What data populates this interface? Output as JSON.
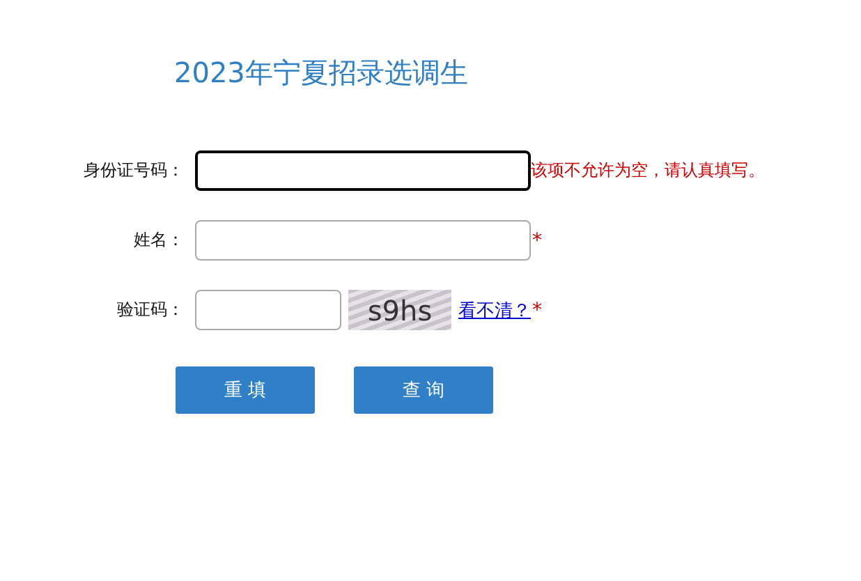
{
  "title": "2023年宁夏招录选调生",
  "fields": [
    {
      "kind": "text",
      "label": "身份证号码：",
      "focused": true,
      "error": "该项不允许为空，请认真填写。",
      "required": false
    },
    {
      "kind": "text",
      "label": "姓名：",
      "focused": false,
      "required": true,
      "required_mark": "*"
    },
    {
      "kind": "captcha",
      "label": "验证码：",
      "focused": false,
      "captcha": "s9hs",
      "refresh_link": "看不清？",
      "required": true,
      "required_mark": "*"
    }
  ],
  "buttons": [
    "重 填",
    "查 询"
  ]
}
